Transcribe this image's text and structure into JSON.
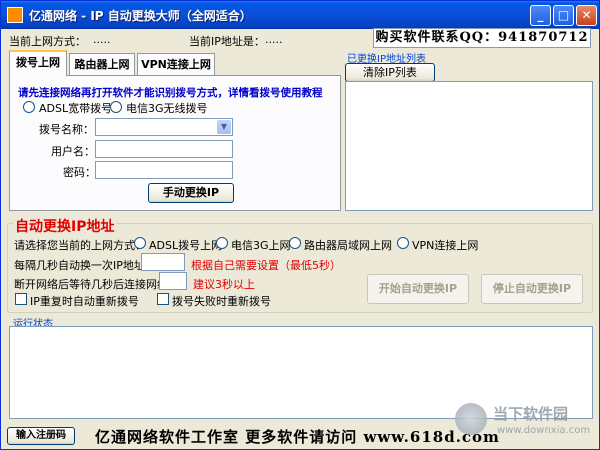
{
  "window": {
    "title": "亿通网络 - IP 自动更换大师（全网适合）",
    "minimize_glyph": "_",
    "maximize_glyph": "□",
    "close_glyph": "✕"
  },
  "header": {
    "connection_mode_label": "当前上网方式：",
    "connection_mode_value": ".....",
    "current_ip_label": "当前IP地址是：",
    "current_ip_value": ".....",
    "purchase_text": "购买软件联系QQ：941870712"
  },
  "tabs": [
    {
      "label": "拨号上网",
      "active": true
    },
    {
      "label": "路由器上网",
      "active": false
    },
    {
      "label": "VPN连接上网",
      "active": false
    }
  ],
  "dial_panel": {
    "notice": "请先连接网络再打开软件才能识别拨号方式，详情看拨号使用教程",
    "radio_adsl": "ADSL宽带拨号",
    "radio_3g": "电信3G无线拨号",
    "dial_name_label": "拨号名称：",
    "dial_name_value": "",
    "username_label": "用户名：",
    "username_value": "",
    "password_label": "密码：",
    "password_value": "",
    "manual_change_button": "手动更换IP"
  },
  "ip_list": {
    "label": "已更换IP地址列表",
    "clear_button": "清除IP列表",
    "items": []
  },
  "auto_change": {
    "title": "自动更换IP地址",
    "select_mode_label": "请选择您当前的上网方式：",
    "mode_options": [
      "ADSL拨号上网",
      "电信3G上网",
      "路由器局域网上网",
      "VPN连接上网"
    ],
    "interval_label": "每隔几秒自动换一次IP地址：",
    "interval_value": "",
    "interval_hint": "根据自己需要设置（最低5秒）",
    "reconnect_label": "断开网络后等待几秒后连接网络：",
    "reconnect_value": "",
    "reconnect_hint": "建议3秒以上",
    "check_ip_repeat": "IP重复时自动重新拨号",
    "check_dial_fail": "拨号失败时重新拨号",
    "start_button": "开始自动更换IP",
    "stop_button": "停止自动更换IP"
  },
  "status": {
    "label": "运行状态",
    "text": ""
  },
  "footer": {
    "register_button": "输入注册码",
    "promo_text": "亿通网络软件工作室 更多软件请访问 www.618d.com"
  },
  "watermark": {
    "name": "当下软件园",
    "url": "www.downxia.com"
  }
}
